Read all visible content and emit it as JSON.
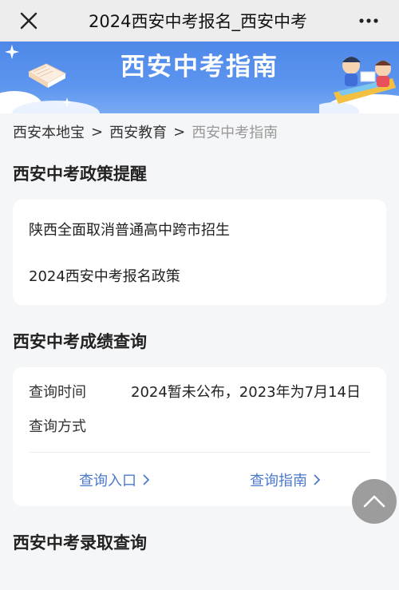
{
  "topbar": {
    "title": "2024西安中考报名_西安中考",
    "close_icon": "close-icon",
    "more_icon": "more-horizontal-icon"
  },
  "banner": {
    "title": "西安中考指南"
  },
  "breadcrumb": {
    "items": [
      "西安本地宝",
      "西安教育",
      "西安中考指南"
    ],
    "separator": ">"
  },
  "policy": {
    "title": "西安中考政策提醒",
    "items": [
      "陕西全面取消普通高中跨市招生",
      "2024西安中考报名政策"
    ]
  },
  "score": {
    "title": "西安中考成绩查询",
    "rows": [
      {
        "label": "查询时间",
        "value": "2024暂未公布，2023年为7月14日"
      },
      {
        "label": "查询方式",
        "value": ""
      }
    ],
    "links": [
      "查询入口",
      "查询指南"
    ]
  },
  "admission": {
    "title": "西安中考录取查询"
  },
  "colors": {
    "banner": "#5c95ef",
    "link": "#4b79cc",
    "background": "#f5f6f8"
  }
}
